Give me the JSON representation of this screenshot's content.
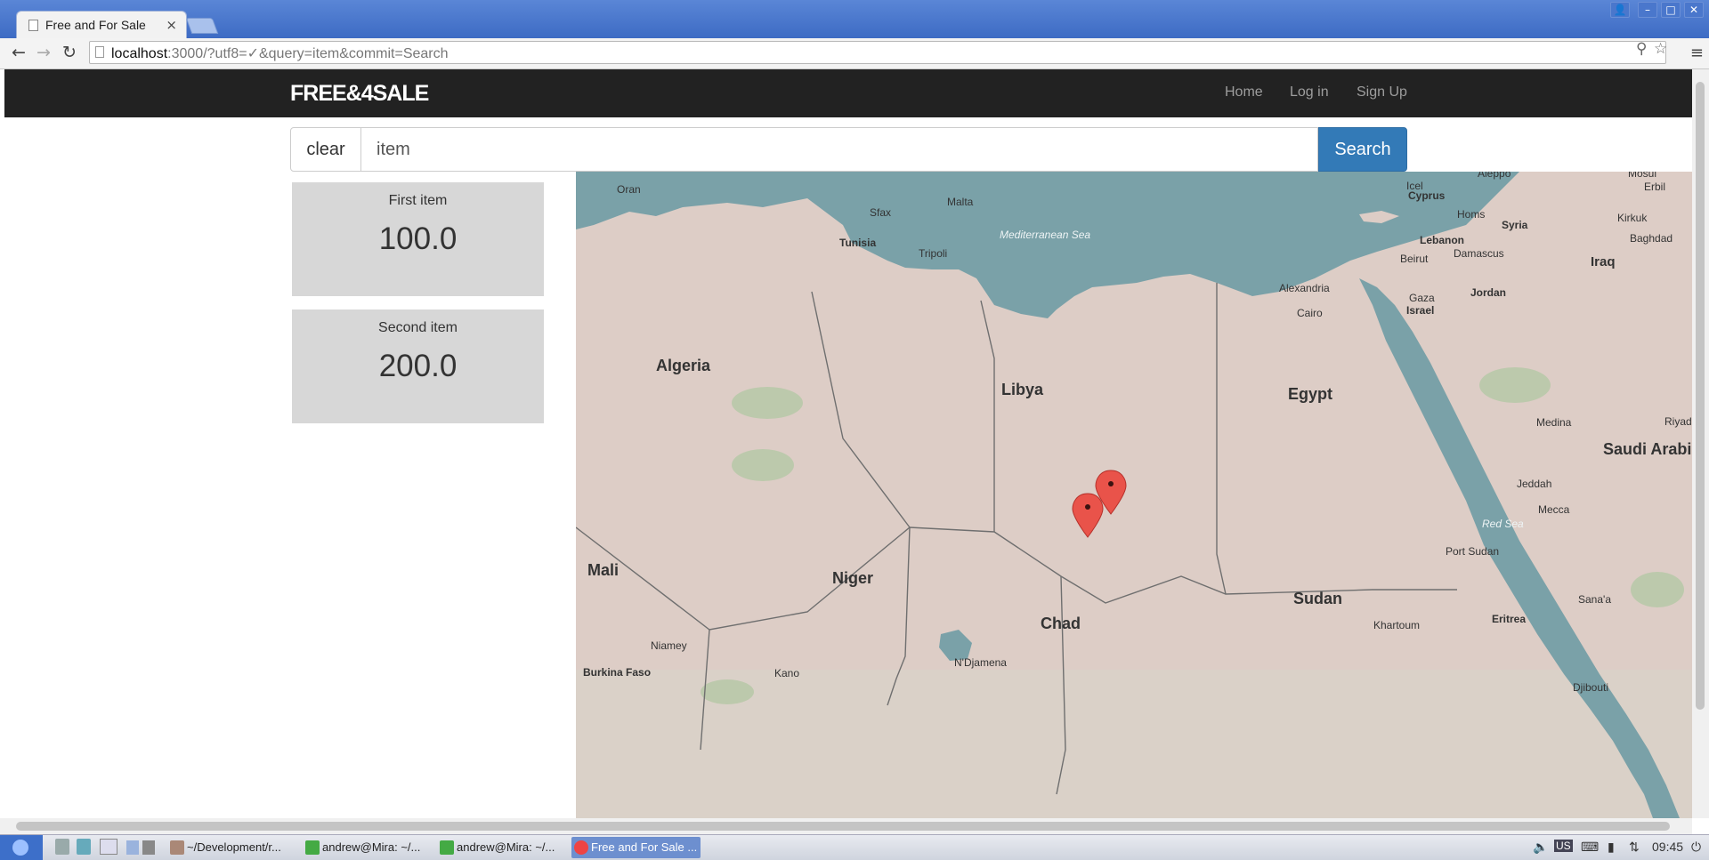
{
  "browser": {
    "tab_title": "Free and For Sale",
    "tab_close": "×",
    "url_host": "localhost",
    "url_rest": ":3000/?utf8=✓&query=item&commit=Search"
  },
  "navbar": {
    "brand": "FREE&4SALE",
    "links": [
      "Home",
      "Log in",
      "Sign Up"
    ]
  },
  "search": {
    "clear_label": "clear",
    "query": "item",
    "submit_label": "Search"
  },
  "items": [
    {
      "name": "First item",
      "price": "100.0"
    },
    {
      "name": "Second item",
      "price": "200.0"
    }
  ],
  "map": {
    "countries": [
      "Algeria",
      "Libya",
      "Egypt",
      "Niger",
      "Chad",
      "Sudan",
      "Mali",
      "Saudi Arabi"
    ],
    "cities": [
      "Oran",
      "Sfax",
      "Tunisia",
      "Tripoli",
      "Malta",
      "Alexandria",
      "Cairo",
      "Gaza",
      "Israel",
      "Jordan",
      "Beirut",
      "Lebanon",
      "Damascus",
      "Syria",
      "Homs",
      "Aleppo",
      "Cyprus",
      "Icel",
      "Mosul",
      "Erbil",
      "Kirkuk",
      "Baghdad",
      "Iraq",
      "Medina",
      "Jeddah",
      "Mecca",
      "Port Sudan",
      "Khartoum",
      "Eritrea",
      "Sana'a",
      "Djibouti",
      "Niamey",
      "Kano",
      "N'Djamena",
      "Burkina Faso",
      "Riyad"
    ],
    "seas": [
      "Mediterranean Sea",
      "Red Sea"
    ],
    "markers": 2
  },
  "taskbar": {
    "apps": [
      "~/Development/r...",
      "andrew@Mira: ~/...",
      "andrew@Mira: ~/...",
      "Free and For Sale ..."
    ],
    "clock": "09:45",
    "keyboard_layout": "US"
  }
}
